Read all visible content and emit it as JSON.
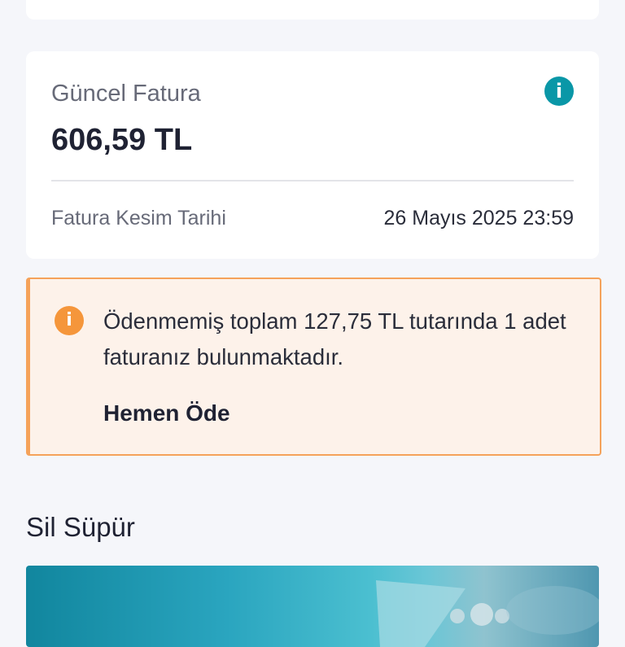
{
  "current_invoice": {
    "label": "Güncel Fatura",
    "amount": "606,59 TL",
    "cutoff_label": "Fatura Kesim Tarihi",
    "cutoff_value": "26 Mayıs 2025 23:59",
    "info_icon": "info-icon",
    "info_glyph": "i"
  },
  "unpaid_alert": {
    "icon": "info-icon",
    "glyph": "i",
    "message": "Ödenmemiş toplam 127,75 TL tutarında 1 adet faturanız bulunmaktadır.",
    "action": "Hemen Öde",
    "accent_color": "#f5a25a",
    "background_color": "#fdf2ea"
  },
  "section": {
    "title": "Sil Süpür"
  },
  "colors": {
    "info_icon": "#0a97a7",
    "page_background": "#f5f6fa"
  }
}
